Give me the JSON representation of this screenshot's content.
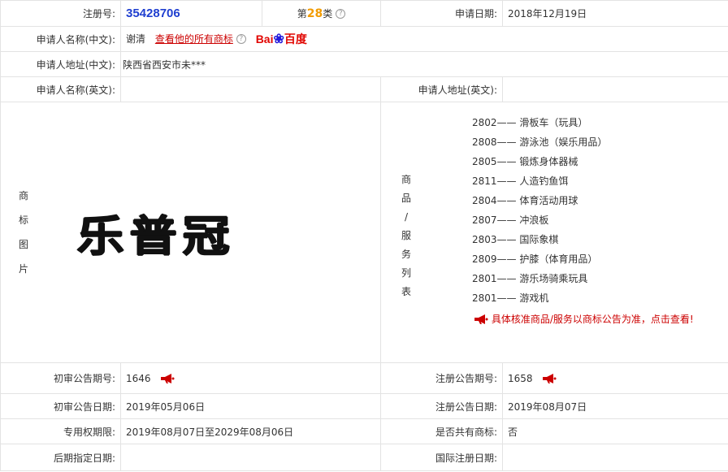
{
  "row1": {
    "reg_label": "注册号:",
    "reg_no": "35428706",
    "class_prefix": "第",
    "class_num": "28",
    "class_suffix": "类",
    "apply_date_label": "申请日期:",
    "apply_date": "2018年12月19日"
  },
  "applicant": {
    "name_cn_label": "申请人名称(中文):",
    "name_cn": "谢清",
    "view_all_link": "查看他的所有商标",
    "baidu_logo": {
      "left": "Bai",
      "paw": "❀",
      "right": "百度"
    },
    "addr_cn_label": "申请人地址(中文):",
    "addr_cn": "陕西省西安市未***",
    "name_en_label": "申请人名称(英文):",
    "name_en": "",
    "addr_en_label": "申请人地址(英文):",
    "addr_en": ""
  },
  "mark": {
    "image_label_chars": [
      "商",
      "标",
      "图",
      "片"
    ],
    "mark_text": "乐普冠"
  },
  "services": {
    "label_chars": [
      "商",
      "品",
      "/",
      "服",
      "务",
      "列",
      "表"
    ],
    "items": [
      {
        "code": "2802",
        "name": "滑板车（玩具）"
      },
      {
        "code": "2808",
        "name": "游泳池（娱乐用品）"
      },
      {
        "code": "2805",
        "name": "锻炼身体器械"
      },
      {
        "code": "2811",
        "name": "人造钓鱼饵"
      },
      {
        "code": "2804",
        "name": "体育活动用球"
      },
      {
        "code": "2807",
        "name": "冲浪板"
      },
      {
        "code": "2803",
        "name": "国际象棋"
      },
      {
        "code": "2809",
        "name": "护膝（体育用品）"
      },
      {
        "code": "2801",
        "name": "游乐场骑乘玩具"
      },
      {
        "code": "2801",
        "name": "游戏机"
      }
    ],
    "separator": "——",
    "notice": "具体核准商品/服务以商标公告为准，点击查看!"
  },
  "announce": {
    "prelim_no_label": "初审公告期号:",
    "prelim_no": "1646",
    "reg_no_label": "注册公告期号:",
    "reg_no": "1658",
    "prelim_date_label": "初审公告日期:",
    "prelim_date": "2019年05月06日",
    "reg_date_label": "注册公告日期:",
    "reg_date": "2019年08月07日",
    "exclusive_label": "专用权期限:",
    "exclusive": "2019年08月07日至2029年08月06日",
    "shared_label": "是否共有商标:",
    "shared": "否",
    "later_label": "后期指定日期:",
    "later": "",
    "intl_label": "国际注册日期:",
    "intl": ""
  },
  "colors": {
    "regno": "#1f3fd0",
    "class_num": "#f29b00",
    "link": "#cc0000",
    "border": "#e3e3e3"
  }
}
